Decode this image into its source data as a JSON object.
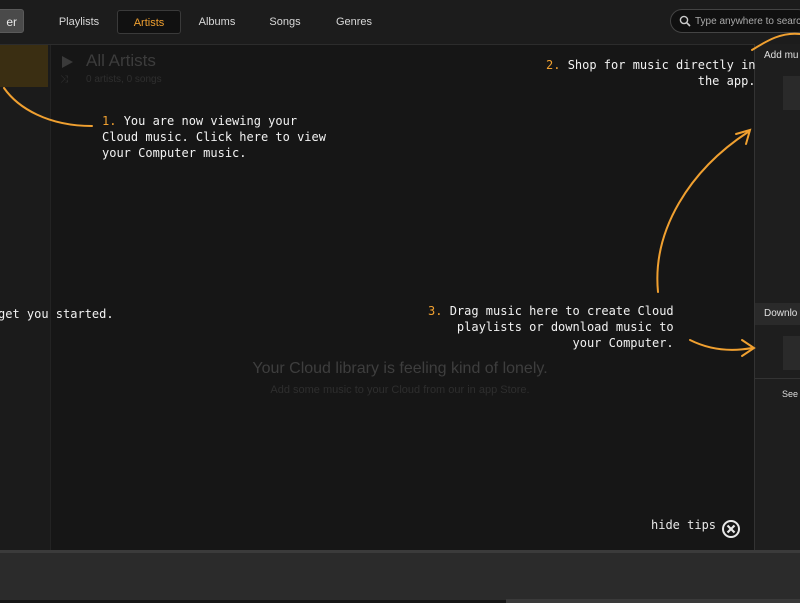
{
  "nav": {
    "left_button": "er",
    "tabs": [
      {
        "label": "Playlists",
        "active": false
      },
      {
        "label": "Artists",
        "active": true
      },
      {
        "label": "Albums",
        "active": false
      },
      {
        "label": "Songs",
        "active": false
      },
      {
        "label": "Genres",
        "active": false
      }
    ],
    "search_placeholder": "Type anywhere to search"
  },
  "main": {
    "title": "All Artists",
    "subtitle": "0 artists, 0 songs",
    "empty_title": "Your Cloud library is feeling kind of lonely.",
    "empty_subtitle": "Add some music to your Cloud from our in app Store."
  },
  "right_panel": {
    "add_music_label": "Add mu",
    "download_label": "Downlo",
    "see_label": "See"
  },
  "tips": {
    "tip1": {
      "number": "1.",
      "line1": "You are now viewing your",
      "line2": "Cloud music. Click here to view",
      "line3": "your Computer music."
    },
    "tip2": {
      "number": "2.",
      "line1": "Shop for music directly in",
      "line2": "the app."
    },
    "tip3": {
      "number": "3.",
      "line1": "Drag music here to create Cloud",
      "line2": "playlists or download music to",
      "line3": "your Computer."
    },
    "tip4": {
      "line1": "get you started."
    },
    "hide_tips": "hide tips"
  },
  "colors": {
    "accent": "#f0a030",
    "background": "#161616"
  }
}
